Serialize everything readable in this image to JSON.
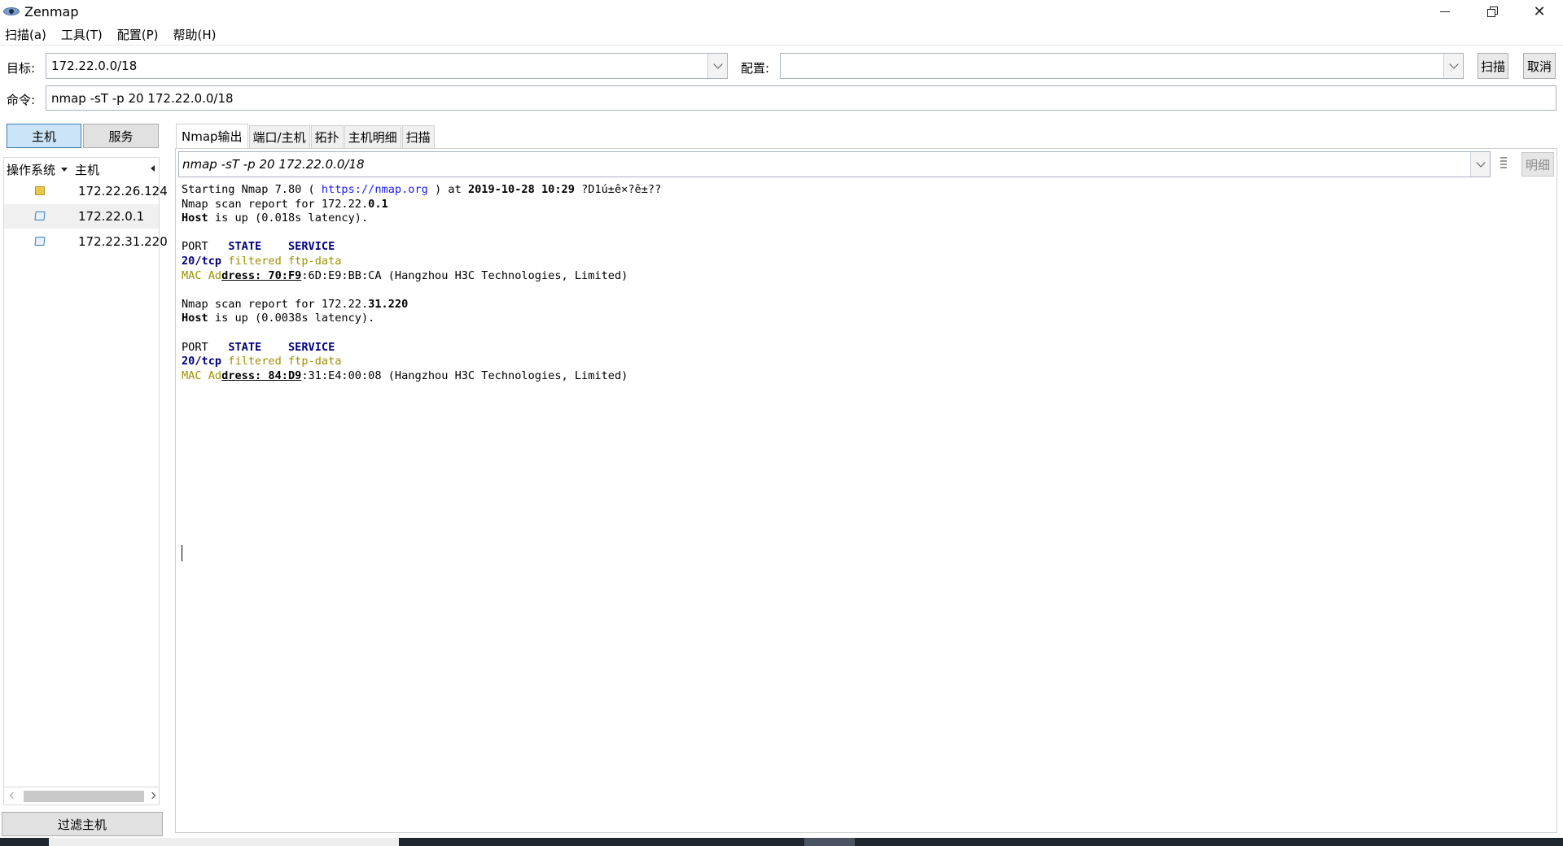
{
  "window": {
    "title": "Zenmap"
  },
  "menu": [
    "扫描(a)",
    "工具(T)",
    "配置(P)",
    "帮助(H)"
  ],
  "toolbar": {
    "target_label": "目标:",
    "target_value": "172.22.0.0/18",
    "profile_label": "配置:",
    "profile_value": "",
    "scan_button": "扫描",
    "cancel_button": "取消",
    "command_label": "命令:",
    "command_value": "nmap -sT -p 20 172.22.0.0/18"
  },
  "sidebar": {
    "hosts_toggle": "主机",
    "services_toggle": "服务",
    "col_os": "操作系统",
    "col_host": "主机",
    "hosts": [
      {
        "ip": "172.22.26.124",
        "os_icon": "unknown-os-icon"
      },
      {
        "ip": "172.22.0.1",
        "os_icon": "windows-os-icon"
      },
      {
        "ip": "172.22.31.220",
        "os_icon": "windows-os-icon"
      }
    ],
    "filter_button": "过滤主机"
  },
  "tabs": [
    "Nmap输出",
    "端口/主机",
    "拓扑",
    "主机明细",
    "扫描"
  ],
  "output_panel": {
    "history_value": "nmap -sT -p 20 172.22.0.0/18",
    "detail_button": "明细",
    "lines": {
      "l1_a": "Starting Nmap 7.80 ( ",
      "l1_link": "https://nmap.org",
      "l1_b": " ) at ",
      "l1_date": "2019-10-28 10:29",
      "l1_c": " ?D1ú±ê×?ê±??",
      "l2_a": "Nmap scan report for 172.22.",
      "l2_b": "0.1",
      "l3_a": "Host",
      "l3_b": " is up (0.018s latency).",
      "hdr_port": "PORT",
      "hdr_state": "STATE",
      "hdr_service": "SERVICE",
      "p1_port": "20/tcp",
      "p1_state": "filtered",
      "p1_service": "ftp-data",
      "m1_a": "MAC Ad",
      "m1_b": "dress: 70:F9",
      "m1_c": ":6D:E9:BB:CA (Hangzhou H3C Technologies, Limited)",
      "l5_a": "Nmap scan report for 172.22.",
      "l5_b": "31.220",
      "l6_a": "Host",
      "l6_b": " is up (0.0038s latency).",
      "p2_port": "20/tcp",
      "p2_state": "filtered",
      "p2_service": "ftp-data",
      "m2_a": "MAC Ad",
      "m2_b": "dress: 84:D9",
      "m2_c": ":31:E4:00:08 (Hangzhou H3C Technologies, Limited)"
    }
  }
}
